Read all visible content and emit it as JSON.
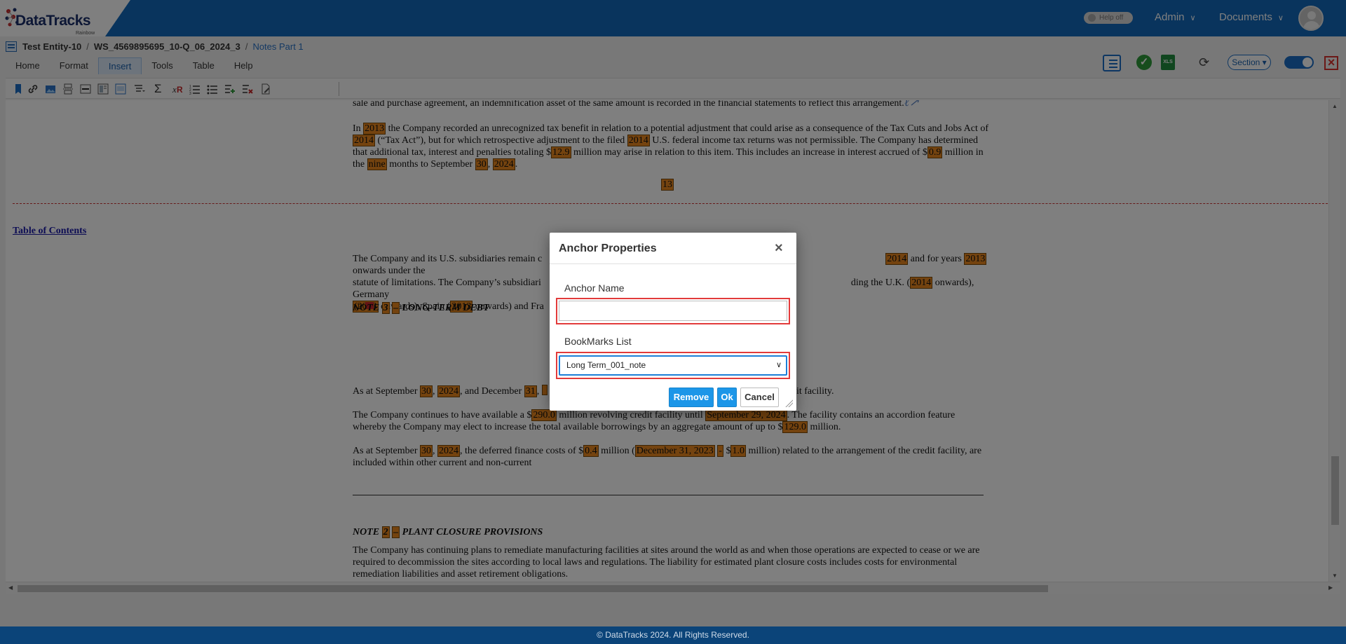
{
  "brand": {
    "name": "DataTracks",
    "sub": "Rainbow"
  },
  "header": {
    "help_toggle": "Help off",
    "nav": [
      {
        "label": "Admin"
      },
      {
        "label": "Documents"
      }
    ]
  },
  "breadcrumb": {
    "entity": "Test Entity-10",
    "workspace": "WS_4569895695_10-Q_06_2024_3",
    "section": "Notes Part 1"
  },
  "menu_tabs": [
    "Home",
    "Format",
    "Insert",
    "Tools",
    "Table",
    "Help"
  ],
  "active_tab": "Insert",
  "section_dropdown": "Section",
  "document": {
    "top_line": "sale and purchase agreement, an indemnification asset of the same amount is recorded in the financial statements to reflect this arrangement.",
    "para1": {
      "t1": "In ",
      "h1": "2013",
      "t2": " the Company recorded an unrecognized tax benefit in relation to a potential adjustment that could arise as a consequence of the Tax Cuts and Jobs Act of ",
      "h2": "2014",
      "t3": " (“Tax Act”), but for which retrospective adjustment to the filed ",
      "h3": "2014",
      "t4": " U.S. federal income tax returns was not permissible. The Company has determined that additional tax, interest and penalties totaling $",
      "h4": "12.9",
      "t5": " million may arise in relation to this item. This includes an increase in interest accrued of $",
      "h5": "0.9",
      "t6": " million in the ",
      "h6": "nine",
      "t7": " months to September ",
      "h7": "30",
      "t8": ", ",
      "h8": "2024",
      "t9": "."
    },
    "page_number": "13",
    "toc_link": "Table of Contents",
    "para2": {
      "t1": "The Company and its U.S. subsidiaries remain c",
      "t2": "",
      "h1": "2014",
      "t3": " and for years ",
      "h2": "2013",
      "t4": " onwards under the",
      "line2a": "statute of limitations. The Company’s subsidiari",
      "line2b": "ding the U.K. (",
      "h3": "2014",
      "line2c": " onwards), Germany",
      "h4": "(2013",
      "t5": " onwards), Spain (",
      "h5": "2013",
      "t6": " onwards) and Fra"
    },
    "note3": {
      "prefix": "NOTE ",
      "num": "3",
      "dash": "–",
      "title": " LONG-TERM DEBT"
    },
    "para3": {
      "t1": "As at September ",
      "h1": "30",
      "t2": ", ",
      "h2": "2024",
      "t3": ", and December ",
      "h3": "31",
      "t4": ", ",
      "tail": "edit facility."
    },
    "para4": {
      "t1": "The Company continues to have available a $",
      "h1": "290.0",
      "t2": " million revolving credit facility until ",
      "h2": "September 29, 2024",
      "t3": ". The facility contains an accordion feature whereby the Company may elect to increase the total available borrowings by an aggregate amount of up to $",
      "h3": "129.0",
      "t4": " million."
    },
    "para5": {
      "t1": "As at September ",
      "h1": "30",
      "t2": ", ",
      "h2": "2024",
      "t3": ", the deferred finance costs of $",
      "h3": "0.4",
      "t4": " million (",
      "h4": "December 31, 2023",
      "t5": " ",
      "h5": "-",
      "t6": " $",
      "h6": "1.0",
      "t7": " million) related to the arrangement of the credit facility, are included within other current and non-current"
    },
    "note2": {
      "prefix": "NOTE ",
      "num": "2",
      "dash": "–",
      "title": " PLANT CLOSURE PROVISIONS"
    },
    "para6": "The Company has continuing plans to remediate manufacturing facilities at sites around the world as and when those operations are expected to cease or we are required to decommission the sites according to local laws and regulations. The liability for estimated plant closure costs includes costs for environmental remediation liabilities and asset retirement obligations."
  },
  "modal": {
    "title": "Anchor Properties",
    "anchor_name_label": "Anchor Name",
    "anchor_name_value": "",
    "bookmarks_label": "BookMarks List",
    "bookmarks_selected": "Long Term_001_note",
    "remove_label": "Remove",
    "ok_label": "Ok",
    "cancel_label": "Cancel"
  },
  "footer": "© DataTracks 2024. All Rights Reserved."
}
